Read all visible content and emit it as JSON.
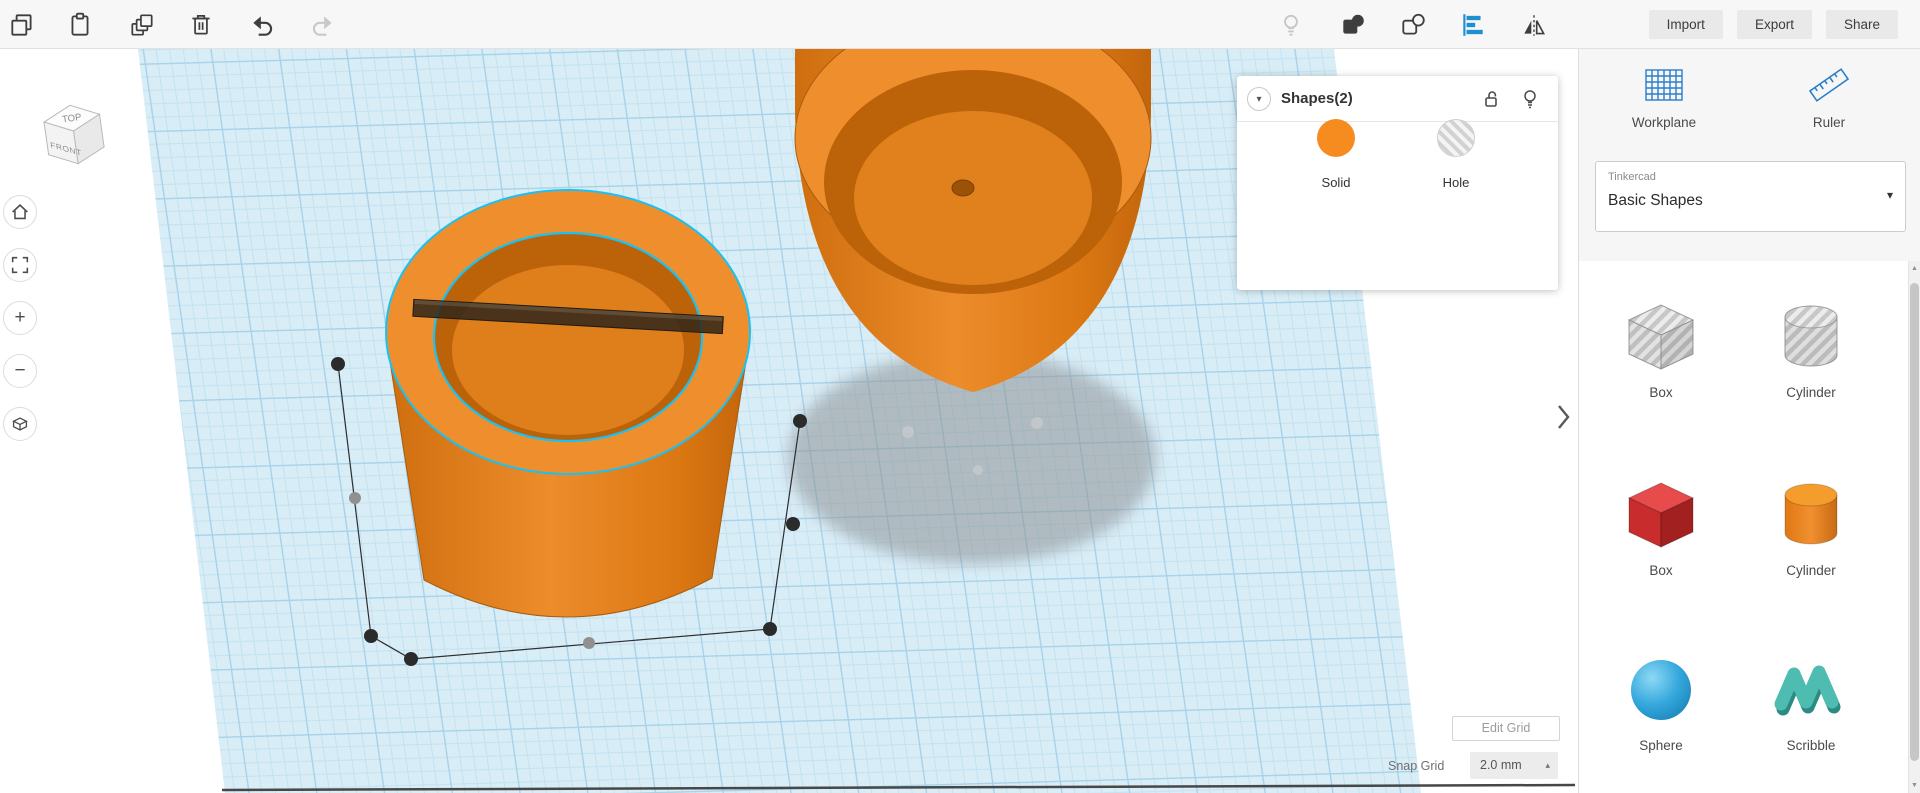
{
  "toolbar": {
    "import_label": "Import",
    "export_label": "Export",
    "share_label": "Share"
  },
  "viewcube": {
    "top_label": "TOP",
    "front_label": "FRONT"
  },
  "shapes_panel": {
    "title": "Shapes(2)",
    "solid_label": "Solid",
    "hole_label": "Hole"
  },
  "sidebar": {
    "workplane_label": "Workplane",
    "ruler_label": "Ruler",
    "brand": "Tinkercad",
    "category": "Basic Shapes",
    "shapes": [
      {
        "label": "Box",
        "variant": "hole-striped-gray"
      },
      {
        "label": "Cylinder",
        "variant": "hole-striped-gray"
      },
      {
        "label": "Box",
        "variant": "solid-red"
      },
      {
        "label": "Cylinder",
        "variant": "solid-orange"
      },
      {
        "label": "Sphere",
        "variant": "solid-blue"
      },
      {
        "label": "Scribble",
        "variant": "solid-teal"
      }
    ]
  },
  "canvas": {
    "edit_grid_label": "Edit Grid",
    "snap_grid_label": "Snap Grid",
    "snap_grid_value": "2.0 mm"
  },
  "icons": {
    "chevron_down": "▾",
    "caret_down": "▾",
    "caret_up": "▴",
    "scroll_up": "▲",
    "scroll_down": "▼",
    "zoom_in": "+",
    "zoom_out": "−"
  },
  "colors": {
    "selection": "#18C2F5",
    "shape_orange": "#E8821C",
    "grid_fill": "#D9EDF7",
    "accent_blue": "#2A7FC9"
  }
}
